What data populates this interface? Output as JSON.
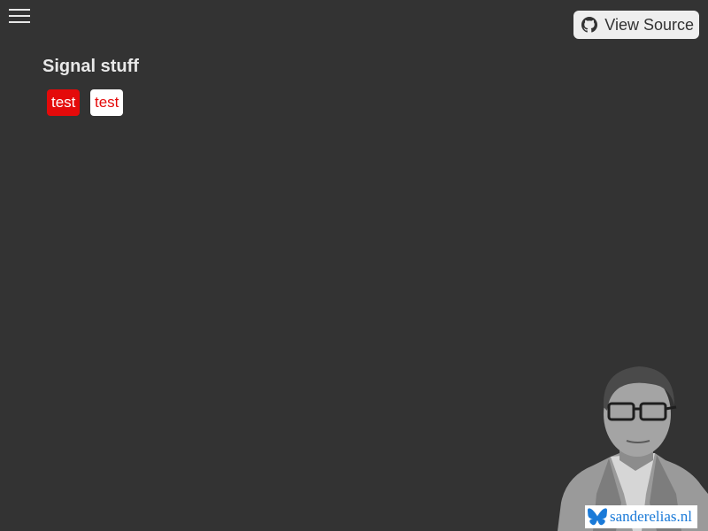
{
  "header": {
    "menu_icon": "hamburger-menu-icon",
    "view_source_label": "View Source",
    "view_source_icon": "github-icon"
  },
  "main": {
    "title": "Signal stuff",
    "chips": [
      {
        "label": "test",
        "style": "red",
        "bg": "#e40a0a",
        "fg": "#ffffff"
      },
      {
        "label": "test",
        "style": "white",
        "bg": "#ffffff",
        "fg": "#e40a0a"
      }
    ]
  },
  "footer_badge": {
    "icon": "butterfly-icon",
    "label": "sanderelias.nl",
    "color": "#1a7ad8"
  },
  "colors": {
    "background": "#333333",
    "text": "#e8e8e8"
  }
}
